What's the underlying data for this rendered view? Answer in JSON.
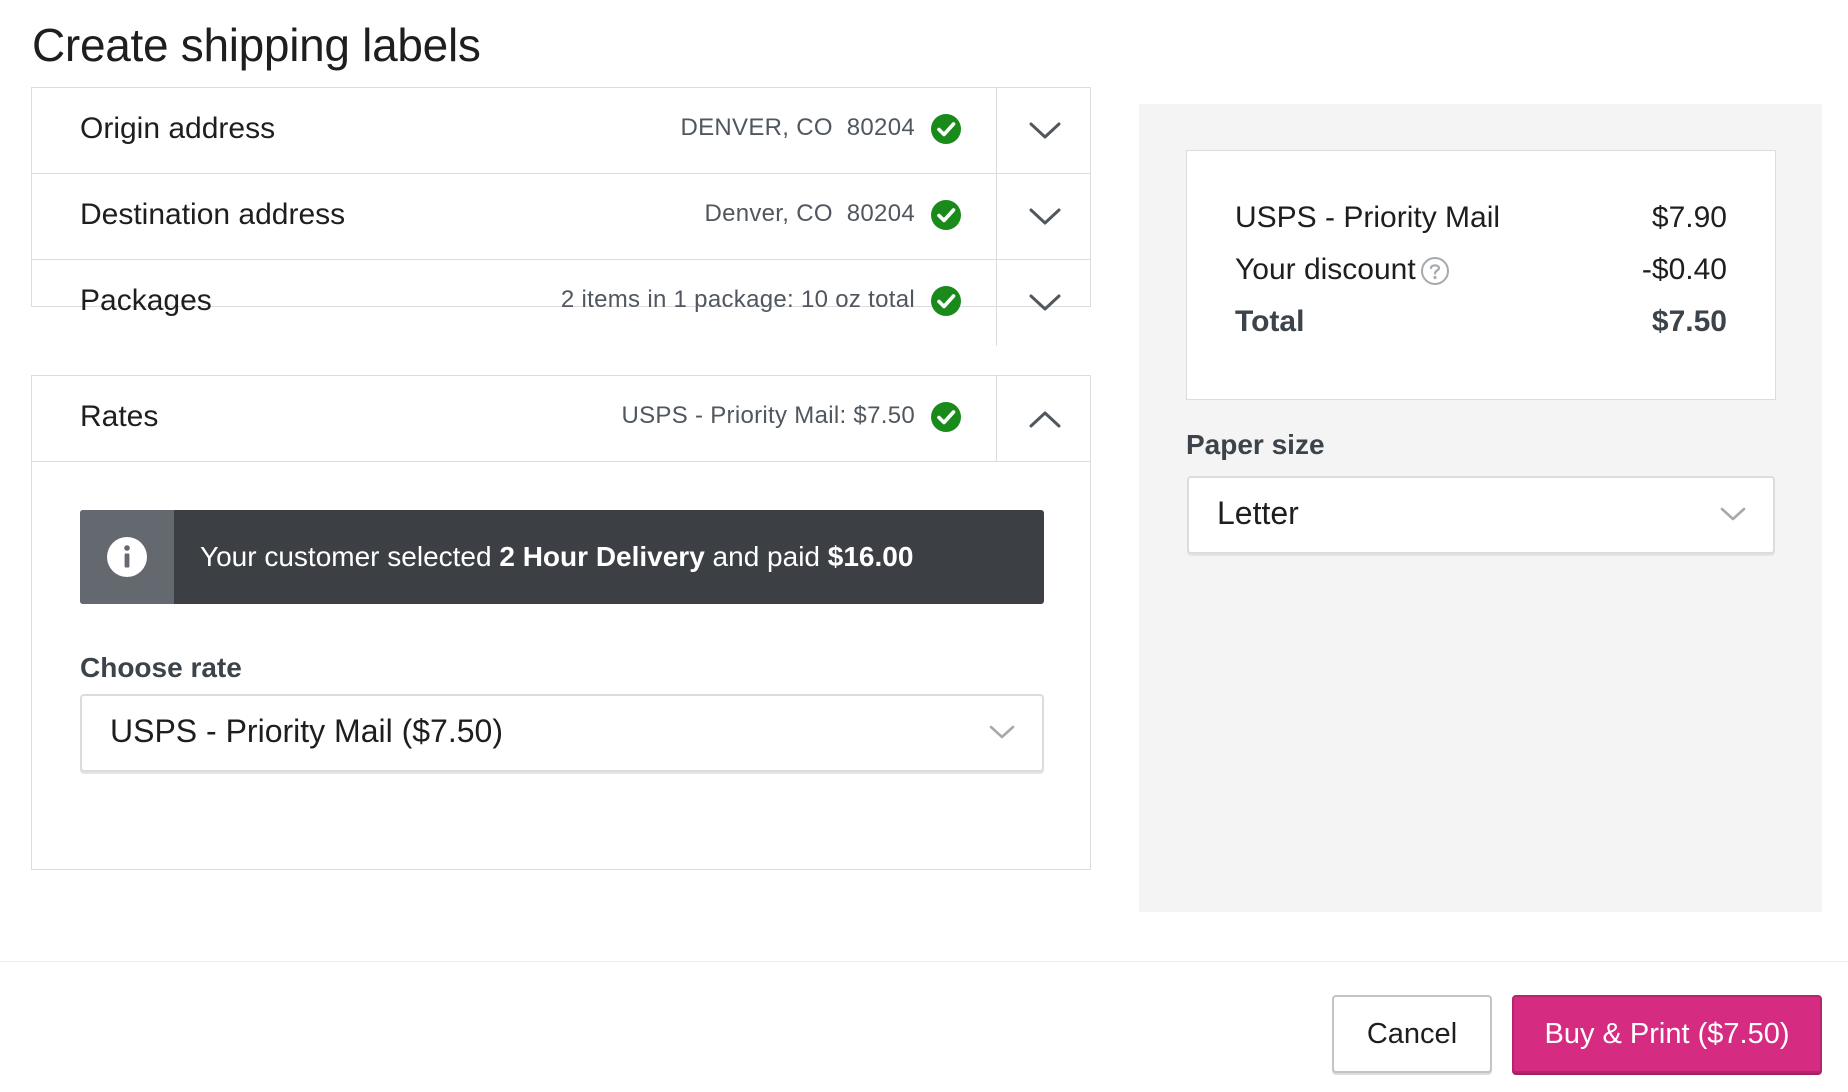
{
  "dialog": {
    "title": "Create shipping labels"
  },
  "steps": [
    {
      "title": "Origin address",
      "summary": "DENVER, CO  80204",
      "status": "complete",
      "expanded": false
    },
    {
      "title": "Destination address",
      "summary": "Denver, CO  80204",
      "status": "complete",
      "expanded": false
    },
    {
      "title": "Packages",
      "summary": "2 items in 1 package: 10 oz total",
      "status": "complete",
      "expanded": false
    },
    {
      "title": "Rates",
      "summary": "USPS - Priority Mail: $7.50",
      "status": "complete",
      "expanded": true
    }
  ],
  "rates": {
    "notice": {
      "prefix": "Your customer selected ",
      "service": "2 Hour Delivery",
      "middle": " and paid ",
      "amount": "$16.00"
    },
    "choose_rate_label": "Choose rate",
    "selected_rate": "USPS - Priority Mail ($7.50)"
  },
  "summary": {
    "rows": [
      {
        "label": "USPS - Priority Mail",
        "amount": "$7.90"
      },
      {
        "label": "Your discount",
        "amount": "-$0.40"
      }
    ],
    "total_label": "Total",
    "total_amount": "$7.50"
  },
  "paper_size": {
    "label": "Paper size",
    "value": "Letter"
  },
  "footer": {
    "cancel_label": "Cancel",
    "primary_label": "Buy & Print ($7.50)"
  },
  "colors": {
    "success": "#1a8a1a",
    "primary": "#d52c82",
    "notice_bg": "#3c3f44"
  }
}
